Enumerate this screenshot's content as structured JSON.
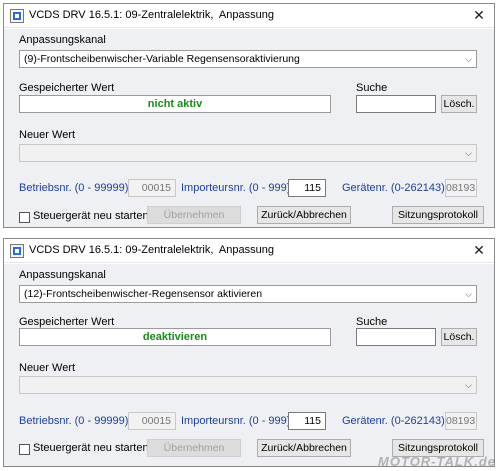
{
  "windows": [
    {
      "title": "VCDS DRV 16.5.1: 09-Zentralelektrik,  Anpassung",
      "close_symbol": "✕",
      "channel_label": "Anpassungskanal",
      "channel_value": "(9)-Frontscheibenwischer-Variable Regensensoraktivierung",
      "stored_label": "Gespeicherter Wert",
      "stored_value": "nicht aktiv",
      "search_label": "Suche",
      "search_value": "",
      "clear_button": "Lösch.",
      "new_value_label": "Neuer Wert",
      "new_value": "",
      "betriebsnr_label": "Betriebsnr. (0 - 99999):",
      "betriebsnr_value": "00015",
      "importeursnr_label": "Importeursnr. (0 - 999):",
      "importeursnr_value": "115",
      "geraetenr_label": "Gerätenr. (0-262143):",
      "geraetenr_value": "08193",
      "restart_label": "Steuergerät neu starten",
      "apply_button": "Übernehmen",
      "back_button": "Zurück/Abbrechen",
      "protocol_button": "Sitzungsprotokoll"
    },
    {
      "title": "VCDS DRV 16.5.1: 09-Zentralelektrik,  Anpassung",
      "close_symbol": "✕",
      "channel_label": "Anpassungskanal",
      "channel_value": "(12)-Frontscheibenwischer-Regensensor aktivieren",
      "stored_label": "Gespeicherter Wert",
      "stored_value": "deaktivieren",
      "search_label": "Suche",
      "search_value": "",
      "clear_button": "Lösch.",
      "new_value_label": "Neuer Wert",
      "new_value": "",
      "betriebsnr_label": "Betriebsnr. (0 - 99999):",
      "betriebsnr_value": "00015",
      "importeursnr_label": "Importeursnr. (0 - 999):",
      "importeursnr_value": "115",
      "geraetenr_label": "Gerätenr. (0-262143):",
      "geraetenr_value": "08193",
      "restart_label": "Steuergerät neu starten",
      "apply_button": "Übernehmen",
      "back_button": "Zurück/Abbrechen",
      "protocol_button": "Sitzungsprotokoll"
    }
  ],
  "watermark": "MOTOR-TALK.de",
  "colors": {
    "stored_value_text": "#1b8a1b",
    "number_labels": "#1f3f9c",
    "panel_background": "#eef0f3"
  }
}
